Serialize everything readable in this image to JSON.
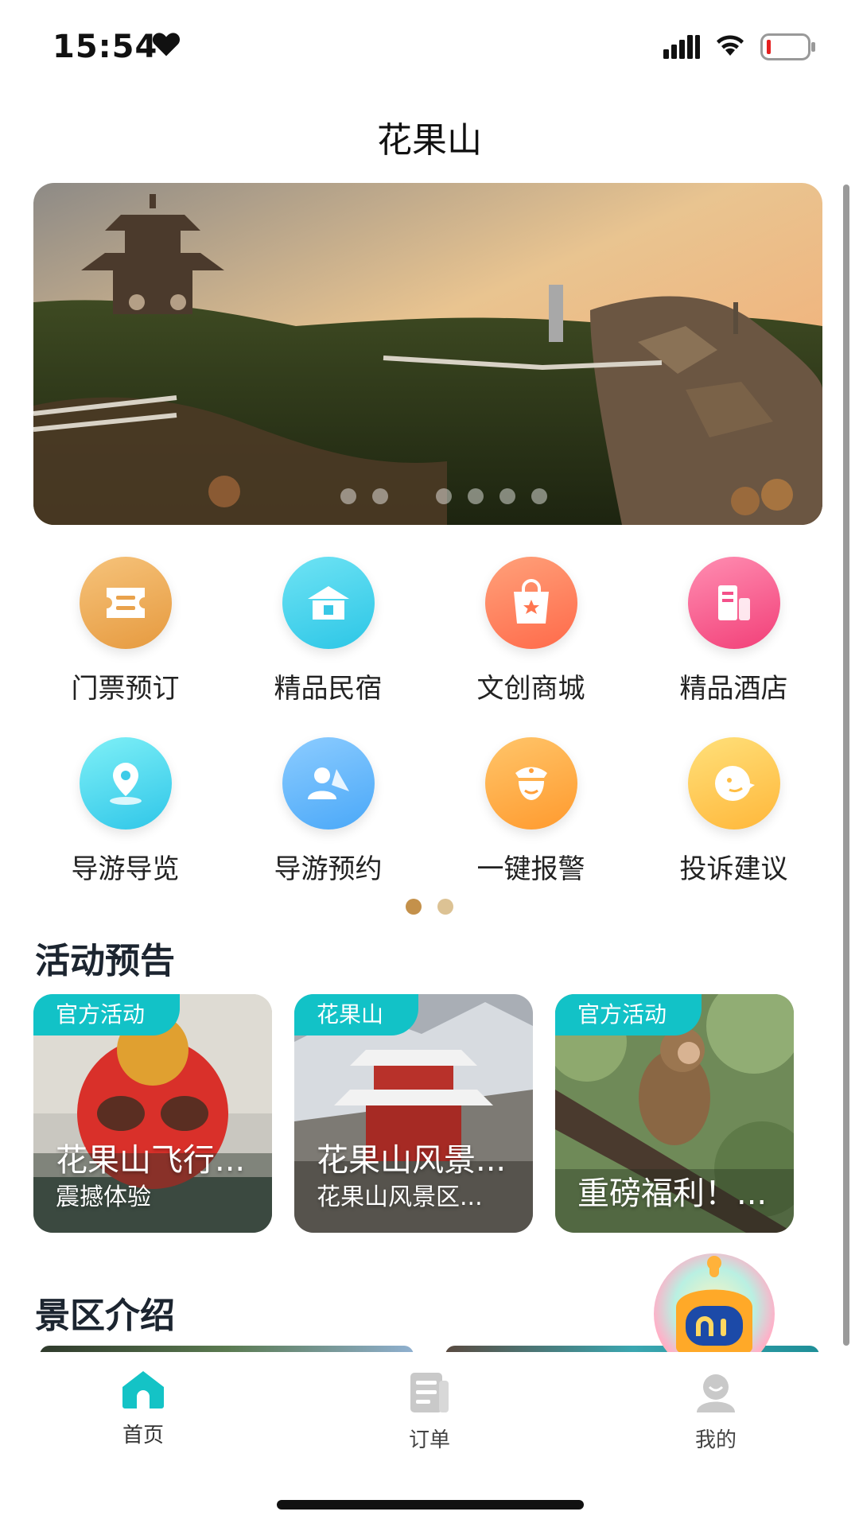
{
  "status_bar": {
    "time": "15:54"
  },
  "page": {
    "title": "花果山"
  },
  "banner": {
    "dot_count": 7,
    "active_dot": 0
  },
  "services": [
    {
      "label": "门票预订",
      "icon": "ticket-icon",
      "color_from": "#f6c37b",
      "color_to": "#e69a3f"
    },
    {
      "label": "精品民宿",
      "icon": "homestay-icon",
      "color_from": "#6fe3f4",
      "color_to": "#2cc6e6"
    },
    {
      "label": "文创商城",
      "icon": "shopping-bag-icon",
      "color_from": "#ffa17a",
      "color_to": "#ff6a4a"
    },
    {
      "label": "精品酒店",
      "icon": "hotel-icon",
      "color_from": "#ff8eb2",
      "color_to": "#f23f78"
    },
    {
      "label": "导游导览",
      "icon": "location-pin-icon",
      "color_from": "#7ff0f7",
      "color_to": "#2fc6e8"
    },
    {
      "label": "导游预约",
      "icon": "guide-icon",
      "color_from": "#8cccff",
      "color_to": "#4aa8f8"
    },
    {
      "label": "一键报警",
      "icon": "police-icon",
      "color_from": "#ffc56a",
      "color_to": "#ff9a2e"
    },
    {
      "label": "投诉建议",
      "icon": "feedback-icon",
      "color_from": "#ffe07a",
      "color_to": "#ffb73a"
    }
  ],
  "pager": {
    "active_color": "#c4914b",
    "inactive_color": "#dcc294"
  },
  "activities": {
    "title": "活动预告",
    "cards": [
      {
        "tag": "官方活动",
        "title": "花果山飞行...",
        "subtitle": "震撼体验"
      },
      {
        "tag": "花果山",
        "title": "花果山风景...",
        "subtitle": "花果山风景区..."
      },
      {
        "tag": "官方活动",
        "title": "重磅福利！...",
        "subtitle": ""
      }
    ]
  },
  "scenic": {
    "title": "景区介绍"
  },
  "tabbar": {
    "tabs": [
      {
        "label": "首页",
        "icon": "home-icon",
        "active": true
      },
      {
        "label": "订单",
        "icon": "order-icon",
        "active": false
      },
      {
        "label": "我的",
        "icon": "profile-icon",
        "active": false
      }
    ],
    "active_color": "#14c3c6",
    "inactive_color": "#c9c9c9"
  }
}
